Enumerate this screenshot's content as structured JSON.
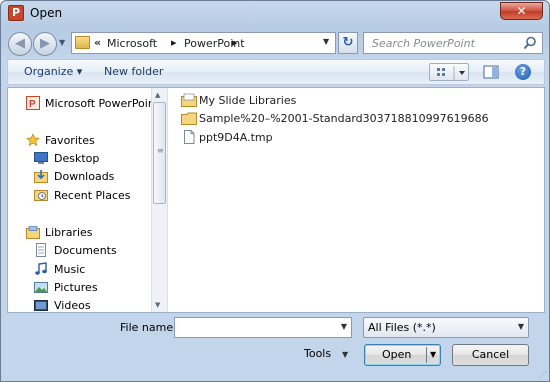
{
  "window": {
    "title": "Open",
    "app_icon_letter": "P",
    "close_glyph": "✕"
  },
  "navigation": {
    "back_glyph": "◀",
    "forward_glyph": "▶",
    "history_glyph": "▼",
    "address": {
      "overflow_glyph": "«",
      "crumbs": [
        "Microsoft",
        "PowerPoint"
      ],
      "chevron": "▸",
      "dropdown_glyph": "▼"
    },
    "refresh_glyph": "↻",
    "search": {
      "placeholder": "Search PowerPoint",
      "icon": "search-icon"
    }
  },
  "toolbar": {
    "organize": "Organize ▾",
    "new_folder": "New folder",
    "views_icon": "views-icon",
    "preview_icon": "preview-pane-icon",
    "help_glyph": "?"
  },
  "nav_pane": {
    "items": [
      {
        "label": "Microsoft PowerPoint",
        "icon": "powerpoint-icon"
      },
      {
        "label": "Favorites",
        "icon": "star-icon"
      },
      {
        "label": "Desktop",
        "icon": "desktop-icon"
      },
      {
        "label": "Downloads",
        "icon": "downloads-icon"
      },
      {
        "label": "Recent Places",
        "icon": "recent-places-icon"
      },
      {
        "label": "Libraries",
        "icon": "libraries-icon"
      },
      {
        "label": "Documents",
        "icon": "documents-icon"
      },
      {
        "label": "Music",
        "icon": "music-icon"
      },
      {
        "label": "Pictures",
        "icon": "pictures-icon"
      },
      {
        "label": "Videos",
        "icon": "videos-icon"
      }
    ],
    "scroll_up": "▲",
    "scroll_down": "▼",
    "scroll_grip": "≡"
  },
  "files": [
    {
      "name": "My Slide Libraries",
      "icon": "slide-library-icon"
    },
    {
      "name": "Sample%20–%2001-Standard303718810997619686",
      "icon": "folder-icon"
    },
    {
      "name": "ppt9D4A.tmp",
      "icon": "file-icon"
    }
  ],
  "bottom": {
    "file_name_label": "File name:",
    "file_name_value": "",
    "dropdown_glyph": "▼",
    "filter_value": "All Files (*.*)",
    "tools_label": "Tools",
    "open_label": "Open",
    "cancel_label": "Cancel",
    "resize_glyph": "⋰"
  },
  "colors": {
    "frame": "#b6cbe4",
    "close": "#c23a2a",
    "accent": "#1f5aa8"
  }
}
